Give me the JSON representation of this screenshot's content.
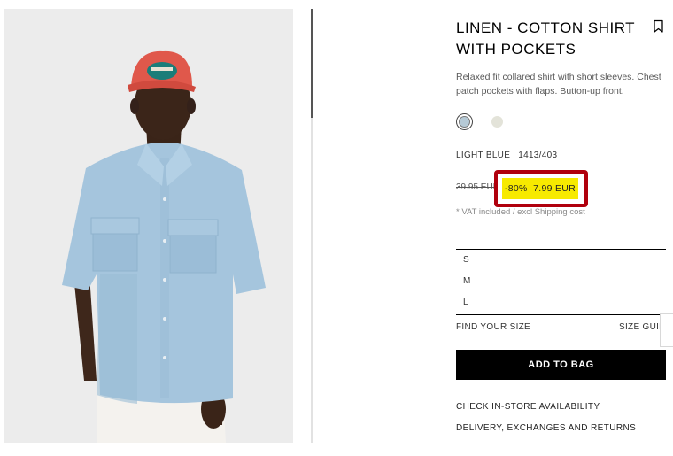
{
  "product": {
    "title": "LINEN - COTTON SHIRT WITH POCKETS",
    "description": "Relaxed fit collared shirt with short sleeves. Chest patch pockets with flaps. Button-up front.",
    "color_reference": "LIGHT BLUE | 1413/403",
    "old_price": "39.95 EUR",
    "discount": "-80%",
    "new_price": "7.99 EUR",
    "vat_note": "* VAT included / excl Shipping cost",
    "image_alt": "model-wearing-light-blue-shirt-and-red-cap"
  },
  "colors": {
    "swatches": [
      {
        "name": "light-blue",
        "hex": "#b6cad6",
        "selected": true
      },
      {
        "name": "ecru",
        "hex": "#e3e3d9",
        "selected": false
      }
    ],
    "highlight_border": "#b0000d",
    "sale_background": "#f7ea00"
  },
  "sizes": [
    "S",
    "M",
    "L"
  ],
  "actions": {
    "find_your_size": "FIND YOUR SIZE",
    "size_guide": "SIZE GUIDE",
    "add_to_bag": "ADD TO BAG",
    "check_store": "CHECK IN-STORE AVAILABILITY",
    "delivery": "DELIVERY, EXCHANGES AND RETURNS"
  },
  "icons": {
    "bookmark": "bookmark-icon"
  }
}
